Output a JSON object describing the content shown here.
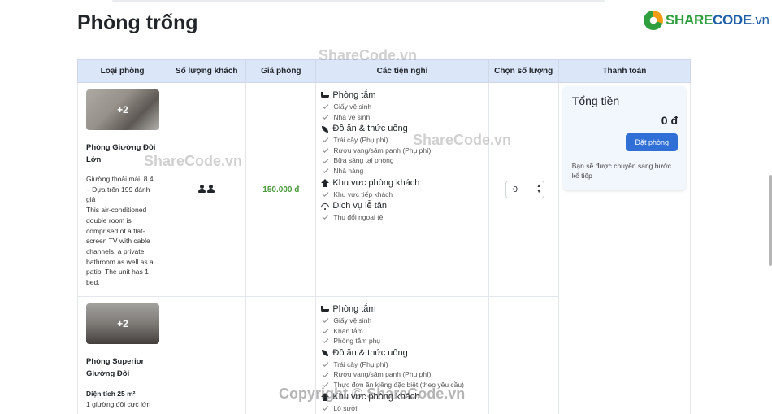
{
  "brand": {
    "part1": "SHARE",
    "part2": "CODE",
    "part3": ".vn"
  },
  "page_title": "Phòng trống",
  "watermarks": [
    "ShareCode.vn",
    "ShareCode.vn",
    "ShareCode.vn",
    "Copyright © ShareCode.vn"
  ],
  "table": {
    "headers": [
      "Loại phòng",
      "Số lượng khách",
      "Giá phòng",
      "Các tiện nghi",
      "Chọn số lượng",
      "Thanh toán"
    ]
  },
  "rooms": [
    {
      "more_photos": "+2",
      "name": "Phòng Giường Đôi Lớn",
      "desc": "Giường thoải mái, 8.4 – Dựa trên 199 đánh giá\nThis air-conditioned double room is comprised of a flat-screen TV with cable channels, a private bathroom as well as a patio. The unit has 1 bed.",
      "price": "150.000 đ",
      "qty": "0",
      "amenities": [
        {
          "title": "Phòng tắm",
          "icon": "bath-icon",
          "items": [
            "Giấy vệ sinh",
            "Nhà vệ sinh"
          ]
        },
        {
          "title": "Đồ ăn & thức uống",
          "icon": "leaf-icon",
          "items": [
            "Trái cây (Phụ phí)",
            "Rượu vang/sâm panh (Phụ phí)",
            "Bữa sáng tại phòng",
            "Nhà hàng"
          ]
        },
        {
          "title": "Khu vực phòng khách",
          "icon": "home-icon",
          "items": [
            "Khu vực tiếp khách"
          ]
        },
        {
          "title": "Dịch vụ lễ tân",
          "icon": "wifi-icon",
          "items": [
            "Thu đổi ngoại tệ"
          ]
        }
      ]
    },
    {
      "more_photos": "+2",
      "name": "Phòng Superior Giường Đôi",
      "area": "Diện tích 25 m²",
      "desc": "1 giường đôi cực lớn",
      "amenities": [
        {
          "title": "Phòng tắm",
          "icon": "bath-icon",
          "items": [
            "Giấy vệ sinh",
            "Khăn tắm",
            "Phòng tắm phụ"
          ]
        },
        {
          "title": "Đồ ăn & thức uống",
          "icon": "leaf-icon",
          "items": [
            "Trái cây (Phụ phí)",
            "Rượu vang/sâm panh (Phụ phí)",
            "Thực đơn ăn kiêng đặc biệt (theo yêu cầu)"
          ]
        },
        {
          "title": "Khu vực phòng khách",
          "icon": "home-icon",
          "items": [
            "Lò sưởi"
          ]
        }
      ]
    }
  ],
  "payment": {
    "title": "Tổng tiền",
    "total": "0 đ",
    "button": "Đặt phòng",
    "note": "Bạn sẽ được chuyển sang bước kế tiếp"
  }
}
